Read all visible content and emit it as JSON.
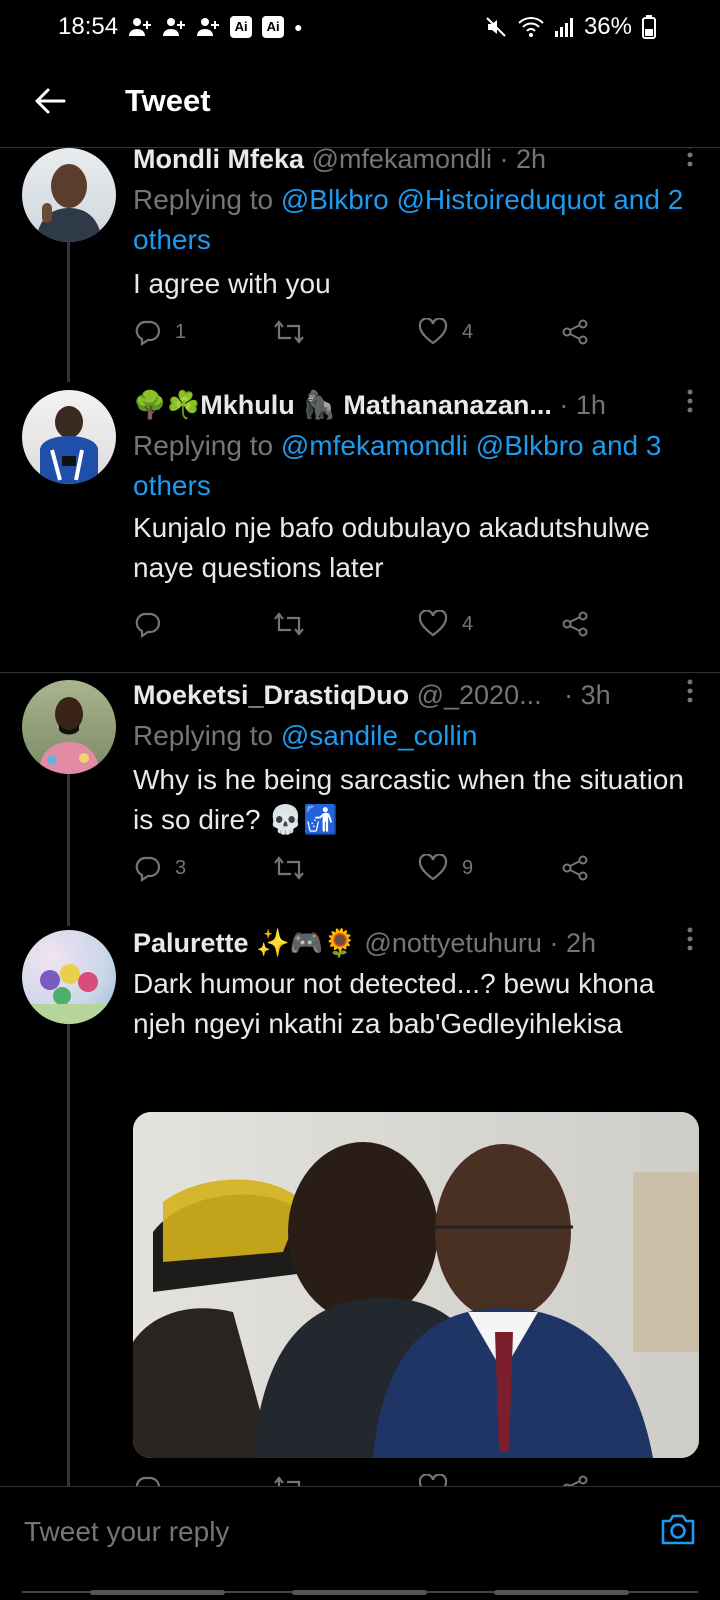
{
  "status_bar": {
    "time": "18:54",
    "ai_badges": [
      "Ai",
      "Ai"
    ],
    "battery": "36%",
    "left_icons": [
      "add-person-icon",
      "add-person-icon",
      "add-person-icon"
    ],
    "right_icons": [
      "mute-icon",
      "wifi-icon",
      "signal-icon",
      "battery-charging-icon"
    ]
  },
  "header": {
    "title": "Tweet"
  },
  "tweets": [
    {
      "name": "Mondli Mfeka",
      "handle": "@mfekamondli",
      "time": "· 2h",
      "replying_prefix": "Replying to",
      "replying_mentions": "@Blkbro @Histoireduquot and 2 others",
      "text": "I agree with you",
      "replies": "1",
      "retweets": "",
      "likes": "4"
    },
    {
      "name_emoji": "🌳☘️",
      "name": "Mkhulu 🦍 Mathananazan...",
      "handle": "",
      "time": "· 1h",
      "replying_prefix": "Replying to",
      "replying_mentions": "@mfekamondli @Blkbro and 3 others",
      "text": "Kunjalo nje bafo odubulayo akadutshulwe naye questions later",
      "replies": "",
      "retweets": "",
      "likes": "4"
    },
    {
      "name": "Moeketsi_DrastiqDuo",
      "handle": "@_2020...",
      "time": "· 3h",
      "replying_prefix": "Replying to",
      "replying_mentions": "@sandile_collin",
      "text": "Why is he being sarcastic when the situation is so dire? 💀🚮",
      "replies": "3",
      "retweets": "",
      "likes": "9"
    },
    {
      "name": "Palurette ✨🎮🌻",
      "handle": "@nottyetuhuru",
      "time": "· 2h",
      "text": "Dark humour not detected...? bewu khona njeh ngeyi nkathi za bab'Gedleyihlekisa"
    }
  ],
  "reply_bar": {
    "placeholder": "Tweet your reply"
  },
  "colors": {
    "background": "#000000",
    "accent": "#1d9bf0",
    "muted": "#71767b",
    "text": "#e7e9ea"
  }
}
